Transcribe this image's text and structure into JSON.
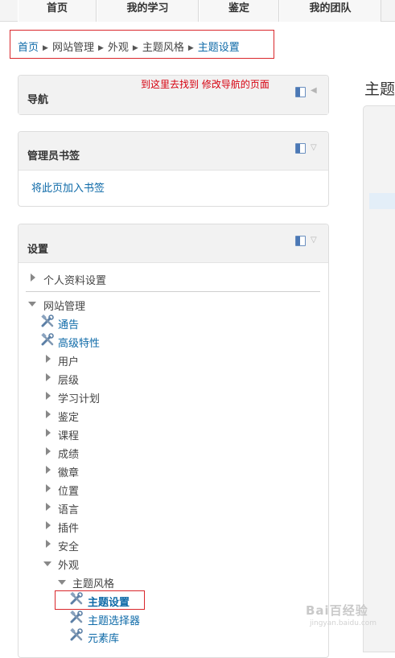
{
  "topnav": {
    "tabs": [
      "首页",
      "我的学习",
      "鉴定",
      "我的团队"
    ]
  },
  "breadcrumb": {
    "items": [
      {
        "label": "首页",
        "link": true
      },
      {
        "label": "网站管理",
        "link": false
      },
      {
        "label": "外观",
        "link": false
      },
      {
        "label": "主题风格",
        "link": false
      },
      {
        "label": "主题设置",
        "link": true
      }
    ],
    "separator": "▶"
  },
  "navigation_block": {
    "title": "导航",
    "annotation": "到这里去找到  修改导航的页面"
  },
  "bookmarks_block": {
    "title": "管理员书签",
    "add_link": "将此页加入书签"
  },
  "settings_block": {
    "title": "设置",
    "profile": "个人资料设置",
    "site_admin": "网站管理",
    "notices": "通告",
    "advanced": "高级特性",
    "categories": [
      "用户",
      "层级",
      "学习计划",
      "鉴定",
      "课程",
      "成绩",
      "徽章",
      "位置",
      "语言",
      "插件",
      "安全"
    ],
    "appearance": "外观",
    "themes": "主题风格",
    "theme_settings": "主题设置",
    "theme_selector": "主题选择器",
    "element_library": "元素库"
  },
  "right": {
    "title": "主题"
  },
  "watermark": {
    "text": "Bai百经验",
    "sub": "jingyan.baidu.com"
  },
  "colors": {
    "link": "#0e6aa8",
    "annotation": "#d6000f",
    "highlight_box": "#d9262b"
  }
}
